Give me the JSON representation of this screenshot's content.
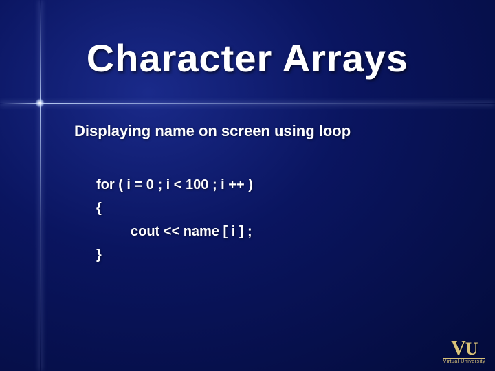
{
  "title": "Character Arrays",
  "subtitle": "Displaying name on screen using loop",
  "code": {
    "line1": "for ( i = 0 ; i < 100 ; i ++ )",
    "line2": "{",
    "line3": "cout << name [ i ] ;",
    "line4": "}"
  },
  "logo": {
    "initials": "VU",
    "name": "Virtual University"
  }
}
